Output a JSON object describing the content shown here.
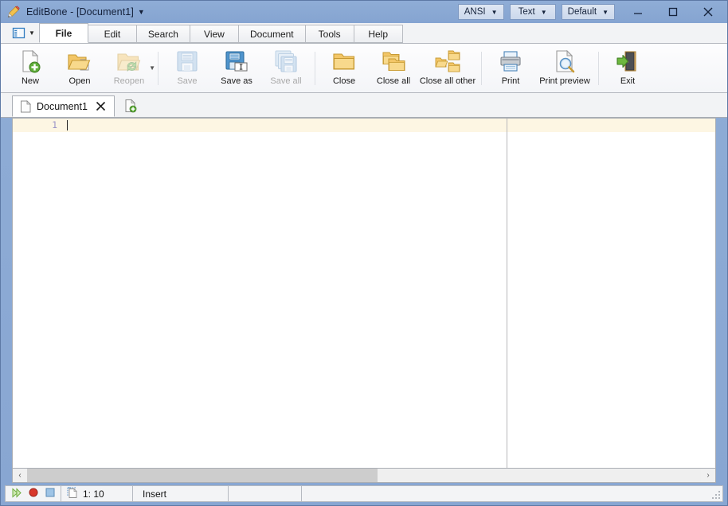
{
  "window": {
    "app_name": "EditBone",
    "title": "EditBone  -  [Document1]",
    "app_icon": "pencil-icon",
    "title_caret": "▼"
  },
  "titlebar": {
    "combos": [
      {
        "label": "ANSI",
        "caret": "▼",
        "name": "encoding-combo"
      },
      {
        "label": "Text",
        "caret": "▼",
        "name": "highlighter-combo"
      },
      {
        "label": "Default",
        "caret": "▼",
        "name": "colors-combo"
      }
    ],
    "buttons": [
      {
        "name": "minimize-button",
        "icon": "minimize-icon"
      },
      {
        "name": "maximize-button",
        "icon": "maximize-icon"
      },
      {
        "name": "close-button",
        "icon": "close-icon"
      }
    ]
  },
  "ribbon": {
    "options_button": {
      "icon": "panel-layout-icon",
      "caret": "▼"
    },
    "tabs": [
      {
        "label": "File",
        "active": true
      },
      {
        "label": "Edit",
        "active": false
      },
      {
        "label": "Search",
        "active": false
      },
      {
        "label": "View",
        "active": false
      },
      {
        "label": "Document",
        "active": false
      },
      {
        "label": "Tools",
        "active": false
      },
      {
        "label": "Help",
        "active": false
      }
    ],
    "items": [
      {
        "label": "New",
        "icon": "new-document-icon",
        "disabled": false,
        "dropdown": false,
        "wide": false
      },
      {
        "label": "Open",
        "icon": "open-folder-icon",
        "disabled": false,
        "dropdown": false,
        "wide": false
      },
      {
        "label": "Reopen",
        "icon": "reopen-folder-icon",
        "disabled": true,
        "dropdown": true,
        "wide": false
      },
      {
        "sep": true
      },
      {
        "label": "Save",
        "icon": "save-floppy-icon",
        "disabled": true,
        "dropdown": false,
        "wide": false
      },
      {
        "label": "Save as",
        "icon": "save-as-floppy-icon",
        "disabled": false,
        "dropdown": false,
        "wide": false
      },
      {
        "label": "Save all",
        "icon": "save-all-floppy-icon",
        "disabled": true,
        "dropdown": false,
        "wide": false
      },
      {
        "sep": true
      },
      {
        "label": "Close",
        "icon": "close-folder-icon",
        "disabled": false,
        "dropdown": false,
        "wide": false
      },
      {
        "label": "Close all",
        "icon": "close-all-folders-icon",
        "disabled": false,
        "dropdown": false,
        "wide": false
      },
      {
        "label": "Close all other",
        "icon": "close-other-folders-icon",
        "disabled": false,
        "dropdown": false,
        "wide": true
      },
      {
        "sep": true
      },
      {
        "label": "Print",
        "icon": "printer-icon",
        "disabled": false,
        "dropdown": false,
        "wide": false
      },
      {
        "label": "Print preview",
        "icon": "print-preview-icon",
        "disabled": false,
        "dropdown": false,
        "wide": true
      },
      {
        "sep": true
      },
      {
        "label": "Exit",
        "icon": "exit-door-icon",
        "disabled": false,
        "dropdown": false,
        "wide": false
      }
    ]
  },
  "doctabs": {
    "tabs": [
      {
        "label": "Document1",
        "icon": "document-icon",
        "close": "✕",
        "active": true
      }
    ],
    "new_tab": {
      "icon": "new-document-icon"
    }
  },
  "editor": {
    "line_numbers": [
      "1"
    ],
    "content": "",
    "active_line": 1,
    "right_margin_column": true
  },
  "scrollbar": {
    "left_arrow": "‹",
    "right_arrow": "›",
    "thumb_percent": 52
  },
  "statusbar": {
    "icons": [
      {
        "name": "macro-play-icon",
        "color": "#7ab648"
      },
      {
        "name": "macro-record-icon",
        "color": "#d8372b"
      },
      {
        "name": "macro-stop-icon",
        "color": "#7aa6d2"
      }
    ],
    "selection_icon": "selection-mode-icon",
    "position": "1: 10",
    "mode": "Insert",
    "cell4": "",
    "cell5": ""
  },
  "colors": {
    "titlebar": "#88a6d2",
    "ribbon": "#f7f8fa",
    "active_line": "#fdf6e3",
    "line_number": "#9a93c8",
    "accent_green": "#7ab648",
    "accent_folder": "#f0c061"
  }
}
